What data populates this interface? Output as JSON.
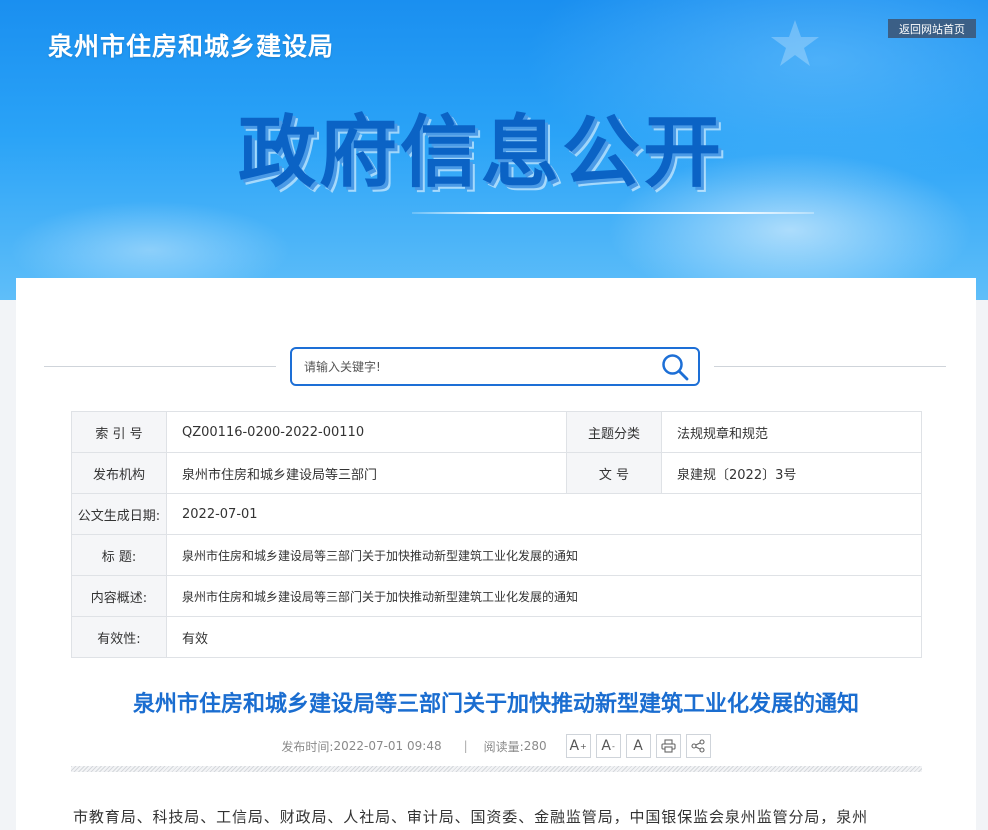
{
  "header": {
    "site_title": "泉州市住房和城乡建设局",
    "home_link": "返回网站首页",
    "banner_title": "政府信息公开"
  },
  "search": {
    "placeholder": "请输入关键字!"
  },
  "info_table": {
    "index_label": "索 引 号",
    "index_value": "QZ00116-0200-2022-00110",
    "topic_label": "主题分类",
    "topic_value": "法规规章和规范",
    "publisher_label": "发布机构",
    "publisher_value": "泉州市住房和城乡建设局等三部门",
    "docno_label": "文 号",
    "docno_value": "泉建规〔2022〕3号",
    "date_label": "公文生成日期:",
    "date_value": "2022-07-01",
    "title_label": "标 题:",
    "title_value": "泉州市住房和城乡建设局等三部门关于加快推动新型建筑工业化发展的通知",
    "summary_label": "内容概述:",
    "summary_value": "泉州市住房和城乡建设局等三部门关于加快推动新型建筑工业化发展的通知",
    "validity_label": "有效性:",
    "validity_value": "有效"
  },
  "article": {
    "title": "泉州市住房和城乡建设局等三部门关于加快推动新型建筑工业化发展的通知",
    "publish_time_label": "发布时间:",
    "publish_time": "2022-07-01 09:48",
    "separator": "|",
    "views_label": "阅读量:",
    "views": "280",
    "first_line": "市教育局、科技局、工信局、财政局、人社局、审计局、国资委、金融监管局，中国银保监会泉州监管分局，泉州"
  },
  "tools": {
    "font_large": "A",
    "font_small": "A",
    "font_normal": "A",
    "font_large_mark": "+",
    "font_small_mark": "-"
  },
  "colors": {
    "accent": "#1a6dd0",
    "banner_blue": "#2aa3f7",
    "home_button": "#3b5f86"
  }
}
